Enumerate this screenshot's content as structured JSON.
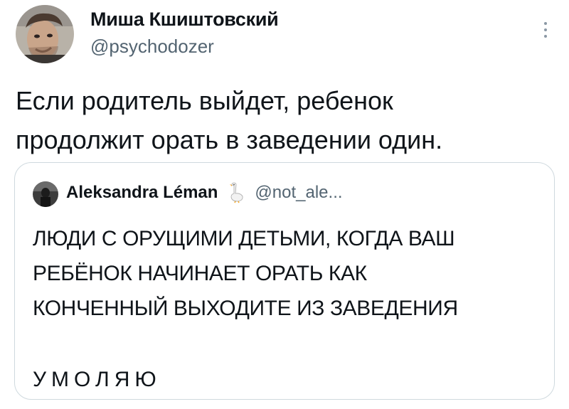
{
  "tweet": {
    "author": {
      "name": "Миша Кшиштовский",
      "handle": "@psychodozer"
    },
    "text_lines": [
      "Если родитель выйдет, ребенок",
      "продолжит орать в заведении один."
    ],
    "more_icon": "more-vertical-icon"
  },
  "quoted_tweet": {
    "author": {
      "name": "Aleksandra Léman",
      "handle": "@not_ale...",
      "badge_icon": "goose-icon"
    },
    "text_lines": [
      "ЛЮДИ С ОРУЩИМИ ДЕТЬМИ, КОГДА ВАШ",
      "РЕБЁНОК НАЧИНАЕТ ОРАТЬ КАК",
      "КОНЧЕННЫЙ ВЫХОДИТЕ ИЗ ЗАВЕДЕНИЯ"
    ],
    "closing_text": "УМОЛЯЮ"
  },
  "colors": {
    "text": "#0f1419",
    "secondary": "#536471",
    "border": "#cfd9de"
  }
}
